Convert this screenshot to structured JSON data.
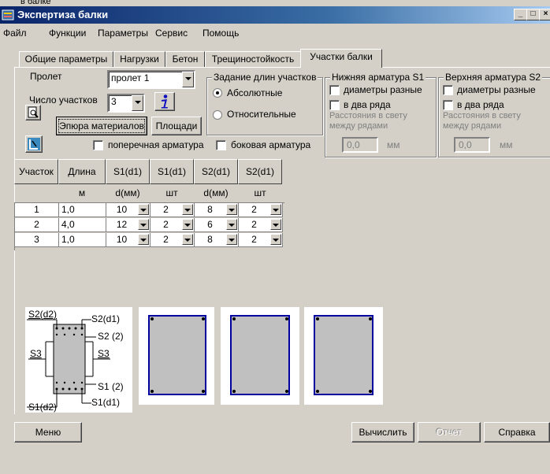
{
  "window": {
    "behind_text": "в балке",
    "title": "Экспертиза балки",
    "controls": [
      "_",
      "□",
      "×"
    ]
  },
  "menu": [
    "Файл",
    "Функции",
    "Параметры",
    "Сервис",
    "Помощь"
  ],
  "tabs": [
    {
      "label": "Общие параметры",
      "active": false
    },
    {
      "label": "Нагрузки",
      "active": false
    },
    {
      "label": "Бетон",
      "active": false
    },
    {
      "label": "Трещиностойкость",
      "active": false
    },
    {
      "label": "Участки балки",
      "active": true
    }
  ],
  "span": {
    "label": "Пролет",
    "value": "пролет 1"
  },
  "sections_count": {
    "label": "Число участков",
    "value": "3"
  },
  "buttons": {
    "materials": "Эпюра материалов",
    "areas": "Площади",
    "menu": "Меню",
    "calculate": "Вычислить",
    "report": "Отчет",
    "help": "Справка"
  },
  "checkboxes": {
    "transverse": "поперечная арматура",
    "side": "боковая арматура"
  },
  "lengths_group": {
    "title": "Задание длин участков",
    "absolute": "Абсолютные",
    "relative": "Относительные",
    "selected": "absolute"
  },
  "bottom_rebar": {
    "title": "Нижняя арматура S1",
    "diff": "диаметры разные",
    "two_rows": "в два ряда",
    "distance_label": "Расстояния в свету между рядами",
    "value": "0,0",
    "unit": "мм"
  },
  "top_rebar": {
    "title": "Верхняя арматура S2",
    "diff": "диаметры разные",
    "two_rows": "в два ряда",
    "distance_label": "Расстояния в свету между рядами",
    "value": "0,0",
    "unit": "мм"
  },
  "grid": {
    "headers": [
      "Участок",
      "Длина",
      "S1(d1)",
      "S1(d1)",
      "S2(d1)",
      "S2(d1)"
    ],
    "units": [
      "",
      "м",
      "d(мм)",
      "шт",
      "d(мм)",
      "шт"
    ],
    "rows": [
      [
        "1",
        "1,0",
        "10",
        "2",
        "8",
        "2"
      ],
      [
        "2",
        "4,0",
        "12",
        "2",
        "6",
        "2"
      ],
      [
        "3",
        "1,0",
        "10",
        "2",
        "8",
        "2"
      ]
    ]
  },
  "legend": {
    "s2d2": "S2(d2)",
    "s2d1": "S2(d1)",
    "s2_2": "S2 (2)",
    "s3_left": "S3",
    "s3_right": "S3",
    "s1_2": "S1 (2)",
    "s1d1": "S1(d1)",
    "s1d2": "S1(d2)"
  },
  "colors": {
    "title_start": "#0a246a",
    "title_end": "#a6caf0",
    "section_border": "#0000a0"
  }
}
